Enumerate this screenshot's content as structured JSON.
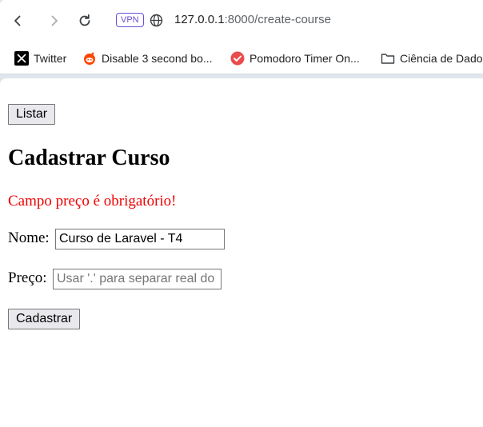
{
  "browser": {
    "vpn_label": "VPN",
    "url_host": "127.0.0.1",
    "url_rest": ":8000/create-course",
    "bookmarks": [
      {
        "label": "Twitter",
        "icon": "x-logo-icon"
      },
      {
        "label": "Disable 3 second bo...",
        "icon": "reddit-icon"
      },
      {
        "label": "Pomodoro Timer On...",
        "icon": "pomodoro-check-icon"
      },
      {
        "label": "Ciência de Dado",
        "icon": "folder-icon"
      }
    ]
  },
  "page": {
    "list_button": "Listar",
    "title": "Cadastrar Curso",
    "error_message": "Campo preço é obrigatório!",
    "name_label": "Nome:",
    "name_value": "Curso de Laravel - T4",
    "price_label": "Preço:",
    "price_placeholder": "Usar '.' para separar real do",
    "submit_button": "Cadastrar"
  },
  "colors": {
    "error": "#ee0000",
    "vpn_accent": "#6b4fd8"
  }
}
